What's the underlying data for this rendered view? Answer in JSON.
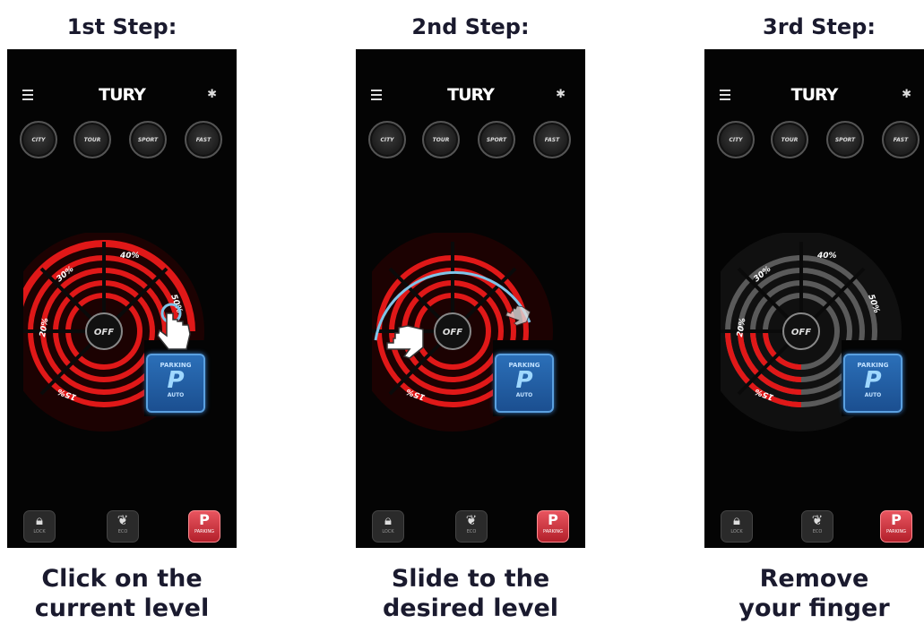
{
  "steps": [
    {
      "title": "1st Step:",
      "caption_line1": "Click on the",
      "caption_line2": "current level",
      "labels": {
        "s1": "20%",
        "s2": "30%",
        "s3": "40%",
        "s4": "50%",
        "s5": "15%"
      },
      "off": "OFF",
      "parking": {
        "top": "PARKING",
        "mid": "P",
        "bottom": "AUTO"
      }
    },
    {
      "title": "2nd Step:",
      "caption_line1": "Slide to the",
      "caption_line2": "desired level",
      "labels": {
        "s1": "",
        "s2": "",
        "s3": "",
        "s4": "",
        "s5": "15%"
      },
      "off": "OFF",
      "parking": {
        "top": "PARKING",
        "mid": "P",
        "bottom": "AUTO"
      }
    },
    {
      "title": "3rd Step:",
      "caption_line1": "Remove",
      "caption_line2": "your finger",
      "labels": {
        "s1": "20%",
        "s2": "30%",
        "s3": "40%",
        "s4": "50%",
        "s5": "15%"
      },
      "off": "OFF",
      "parking": {
        "top": "PARKING",
        "mid": "P",
        "bottom": "AUTO"
      }
    }
  ],
  "app": {
    "brand": "TURY",
    "modes": [
      "CITY",
      "TOUR",
      "SPORT",
      "FAST"
    ],
    "footer": [
      {
        "icon": "lock-icon",
        "label": "LOCK"
      },
      {
        "icon": "leaf-icon",
        "label": "ECO"
      },
      {
        "icon": "parking-p-icon",
        "label": "PARKING",
        "glyph": "P"
      }
    ]
  },
  "colors": {
    "active_red": "#e01818",
    "inactive_gray": "#5a5a5a",
    "slide_arc": "#7fc4e8",
    "parking_blue": "#2b6fb8"
  }
}
